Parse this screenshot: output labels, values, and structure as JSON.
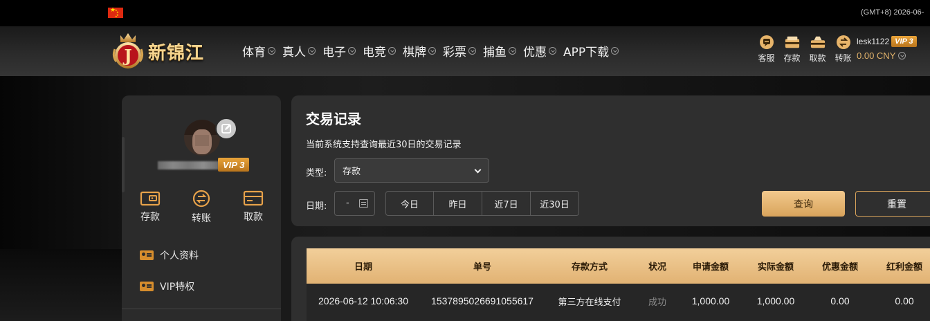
{
  "top": {
    "timezone": "(GMT+8) 2026-06-"
  },
  "brand": {
    "name": "新锦江"
  },
  "nav": [
    {
      "label": "体育"
    },
    {
      "label": "真人"
    },
    {
      "label": "电子"
    },
    {
      "label": "电竞"
    },
    {
      "label": "棋牌"
    },
    {
      "label": "彩票"
    },
    {
      "label": "捕鱼"
    },
    {
      "label": "优惠"
    },
    {
      "label": "APP下载"
    }
  ],
  "header_actions": [
    {
      "label": "客服",
      "icon": "support-icon"
    },
    {
      "label": "存款",
      "icon": "deposit-icon"
    },
    {
      "label": "取款",
      "icon": "withdraw-icon"
    },
    {
      "label": "转账",
      "icon": "transfer-icon"
    }
  ],
  "user": {
    "username": "lesk1122",
    "vip": "VIP 3",
    "balance": "0.00 CNY"
  },
  "sidebar": {
    "vip": "VIP 3",
    "wallet": [
      {
        "label": "存款",
        "icon": "wallet-deposit-icon"
      },
      {
        "label": "转账",
        "icon": "wallet-transfer-icon"
      },
      {
        "label": "取款",
        "icon": "wallet-withdraw-icon"
      }
    ],
    "menu": [
      {
        "label": "个人资料"
      },
      {
        "label": "VIP特权"
      }
    ]
  },
  "search": {
    "title": "交易记录",
    "note": "当前系统支持查询最近30日的交易记录",
    "type_label": "类型:",
    "type_value": "存款",
    "date_label": "日期:",
    "date_placeholder": "-",
    "quick": [
      {
        "label": "今日"
      },
      {
        "label": "昨日"
      },
      {
        "label": "近7日"
      },
      {
        "label": "近30日"
      }
    ],
    "query_label": "查询",
    "reset_label": "重置"
  },
  "table": {
    "columns": [
      "日期",
      "单号",
      "存款方式",
      "状况",
      "申请金额",
      "实际金额",
      "优惠金额",
      "红利金额"
    ],
    "rows": [
      [
        "2026-06-12 10:06:30",
        "1537895026691055617",
        "第三方在线支付",
        "成功",
        "1,000.00",
        "1,000.00",
        "0.00",
        "0.00"
      ]
    ]
  },
  "colors": {
    "accent": "#e1b273",
    "button": "#d8a35b",
    "panel": "#2f2f2f"
  }
}
